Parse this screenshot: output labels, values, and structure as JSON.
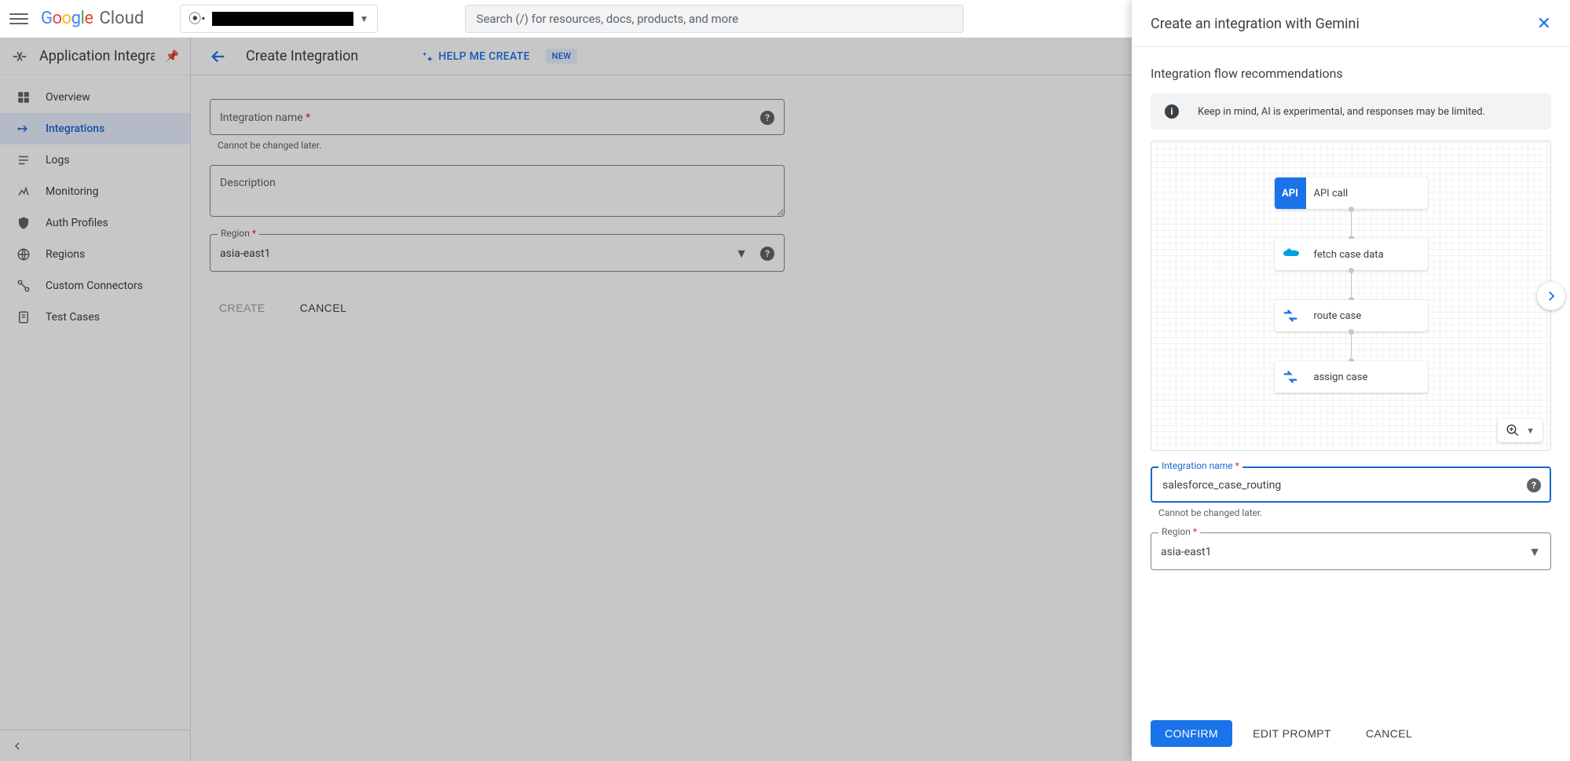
{
  "topbar": {
    "logo_cloud": "Cloud",
    "project_redacted": "",
    "search_placeholder": "Search (/) for resources, docs, products, and more"
  },
  "leftnav": {
    "product_title": "Application Integration",
    "items": [
      {
        "label": "Overview"
      },
      {
        "label": "Integrations"
      },
      {
        "label": "Logs"
      },
      {
        "label": "Monitoring"
      },
      {
        "label": "Auth Profiles"
      },
      {
        "label": "Regions"
      },
      {
        "label": "Custom Connectors"
      },
      {
        "label": "Test Cases"
      }
    ]
  },
  "main": {
    "page_title": "Create Integration",
    "help_create": "HELP ME CREATE",
    "new_badge": "NEW",
    "form": {
      "name_label": "Integration name",
      "name_hint": "Cannot be changed later.",
      "desc_placeholder": "Description",
      "region_label": "Region",
      "region_value": "asia-east1",
      "create": "CREATE",
      "cancel": "CANCEL"
    }
  },
  "panel": {
    "title": "Create an integration with Gemini",
    "subtitle": "Integration flow recommendations",
    "banner": "Keep in mind, AI is experimental, and responses may be limited.",
    "flow": [
      {
        "label": "API call",
        "icon": "api"
      },
      {
        "label": "fetch case data",
        "icon": "salesforce"
      },
      {
        "label": "route case",
        "icon": "mapping"
      },
      {
        "label": "assign case",
        "icon": "mapping"
      }
    ],
    "form": {
      "name_label": "Integration name",
      "name_value": "salesforce_case_routing",
      "name_hint": "Cannot be changed later.",
      "region_label": "Region",
      "region_value": "asia-east1"
    },
    "buttons": {
      "confirm": "CONFIRM",
      "edit": "EDIT PROMPT",
      "cancel": "CANCEL"
    }
  }
}
